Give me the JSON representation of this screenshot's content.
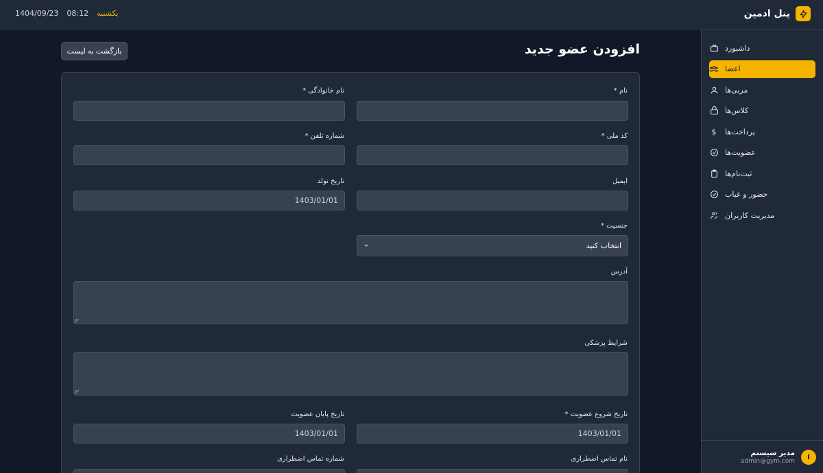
{
  "topbar": {
    "brand_title": "پنل ادمین",
    "date": "1404/09/23",
    "time": "08:12",
    "day": "یکشنبه"
  },
  "sidebar": {
    "items": [
      {
        "label": "داشبورد",
        "icon": "dashboard-icon",
        "active": false
      },
      {
        "label": "اعضا",
        "icon": "members-icon",
        "active": true
      },
      {
        "label": "مربی‌ها",
        "icon": "coach-icon",
        "active": false
      },
      {
        "label": "کلاس‌ها",
        "icon": "class-icon",
        "active": false
      },
      {
        "label": "پرداخت‌ها",
        "icon": "dollar-icon",
        "active": false
      },
      {
        "label": "عضویت‌ها",
        "icon": "check-circle-icon",
        "active": false
      },
      {
        "label": "ثبت‌نام‌ها",
        "icon": "clipboard-icon",
        "active": false
      },
      {
        "label": "حضور و غیاب",
        "icon": "attendance-icon",
        "active": false
      },
      {
        "label": "مدیریت کاربران",
        "icon": "user-management-icon",
        "active": false
      }
    ],
    "user": {
      "initial": "ا",
      "name": "مدیر سیستم",
      "email": "admin@gym.com"
    }
  },
  "main": {
    "title": "افزودن عضو جدید",
    "back_label": "بازگشت به لیست"
  },
  "form": {
    "first_name": {
      "label": "نام *",
      "value": ""
    },
    "last_name": {
      "label": "نام خانوادگی *",
      "value": ""
    },
    "national_code": {
      "label": "کد ملی *",
      "value": ""
    },
    "phone": {
      "label": "شماره تلفن *",
      "value": ""
    },
    "email": {
      "label": "ایمیل",
      "value": ""
    },
    "birth_date": {
      "label": "تاریخ تولد",
      "value": "1403/01/01"
    },
    "gender": {
      "label": "جنسیت *",
      "value": "انتخاب کنید"
    },
    "address": {
      "label": "آدرس"
    },
    "medical": {
      "label": "شرایط پزشکی"
    },
    "membership_start": {
      "label": "تاریخ شروع عضویت *",
      "value": "1403/01/01"
    },
    "membership_end": {
      "label": "تاریخ پایان عضویت",
      "value": "1403/01/01"
    },
    "emergency_name": {
      "label": "نام تماس اضطراری"
    },
    "emergency_phone": {
      "label": "شماره تماس اضطراری"
    }
  },
  "colors": {
    "accent": "#f5b400",
    "bg": "#111827",
    "panel": "#1f2937",
    "field": "#374151"
  }
}
